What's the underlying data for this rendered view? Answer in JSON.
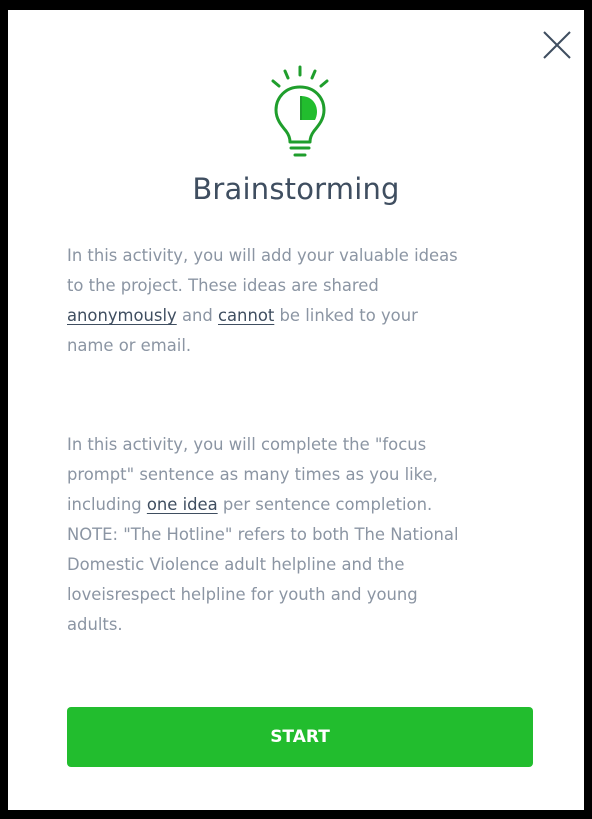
{
  "dialog": {
    "close_icon": "close-icon",
    "illustration_icon": "lightbulb-icon",
    "title": "Brainstorming",
    "intro": {
      "line1": "In this activity, you will add your valuable ideas",
      "line2": "to the project. These ideas are shared",
      "line3_link1": "anonymously",
      "line3_mid": " and ",
      "line3_link2": "cannot",
      "line3_end": " be linked to your",
      "line4": "name or email."
    },
    "details": {
      "line1": "In this activity, you will complete the \"focus",
      "line2": "prompt\" sentence as many times as you like,",
      "line3_start": "including ",
      "line3_link": "one idea",
      "line3_end": " per sentence completion.",
      "line4": "NOTE: \"The Hotline\" refers to both The National",
      "line5": "Domestic Violence adult helpline and the",
      "line6": "loveisrespect helpline for youth and young",
      "line7": "adults."
    },
    "start_label": "START"
  },
  "colors": {
    "accent_green": "#22bd2e",
    "bulb_green": "#1f9e2c",
    "title_text": "#3f4e60",
    "body_text": "#8b95a3"
  }
}
